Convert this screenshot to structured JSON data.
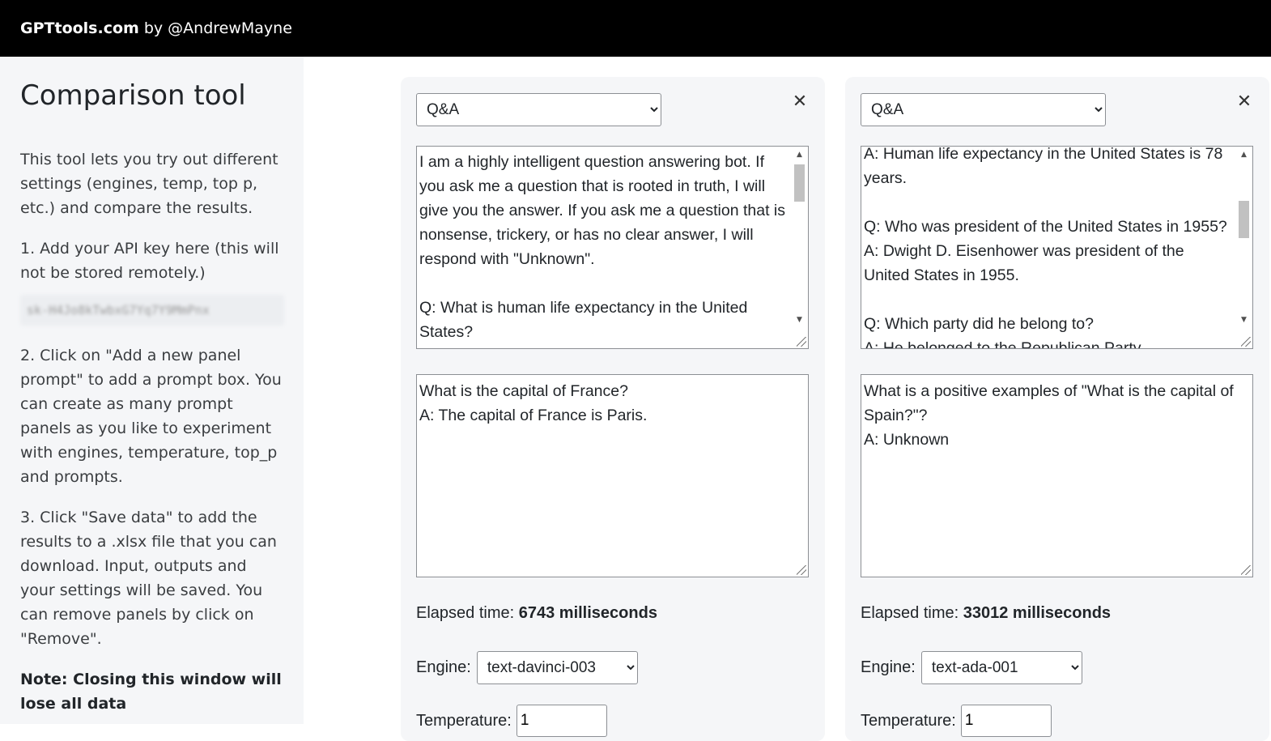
{
  "header": {
    "brand": "GPTtools.com",
    "byline": "by @AndrewMayne"
  },
  "sidebar": {
    "title": "Comparison tool",
    "intro": "This tool lets you try out different settings (engines, temp, top p, etc.) and compare the results.",
    "step1": "1. Add your API key here (this will not be stored remotely.)",
    "api_key_value": "sk-H4Jo8kTwbxG7Yq7Y9MmPnx",
    "step2": "2. Click on \"Add a new panel prompt\" to add a prompt box. You can create as many prompt panels as you like to experiment with engines, temperature, top_p and prompts.",
    "step3": "3. Click \"Save data\" to add the results to a .xlsx file that you can download. Input, outputs and your settings will be saved. You can remove panels by click on \"Remove\".",
    "note": "Note: Closing this window will lose all data"
  },
  "panels": [
    {
      "preset": "Q&A",
      "close_glyph": "✕",
      "prompt_text": "I am a highly intelligent question answering bot. If you ask me a question that is rooted in truth, I will give you the answer. If you ask me a question that is nonsense, trickery, or has no clear answer, I will respond with \"Unknown\".\n\nQ: What is human life expectancy in the United States?",
      "output_text": "What is the capital of France?\nA: The capital of France is Paris.",
      "elapsed_label": "Elapsed time:",
      "elapsed_value": "6743 milliseconds",
      "engine_label": "Engine:",
      "engine": "text-davinci-003",
      "temperature_label": "Temperature:",
      "temperature": "1"
    },
    {
      "preset": "Q&A",
      "close_glyph": "✕",
      "prompt_text": "A: Human life expectancy in the United States is 78 years.\n\nQ: Who was president of the United States in 1955?\nA: Dwight D. Eisenhower was president of the United States in 1955.\n\nQ: Which party did he belong to?\nA: He belonged to the Republican Party.",
      "output_text": "What is a positive examples of \"What is the capital of Spain?\"?\nA: Unknown",
      "elapsed_label": "Elapsed time:",
      "elapsed_value": "33012 milliseconds",
      "engine_label": "Engine:",
      "engine": "text-ada-001",
      "temperature_label": "Temperature:",
      "temperature": "1"
    }
  ],
  "scrollbar_glyphs": {
    "up": "▲",
    "down": "▼"
  }
}
